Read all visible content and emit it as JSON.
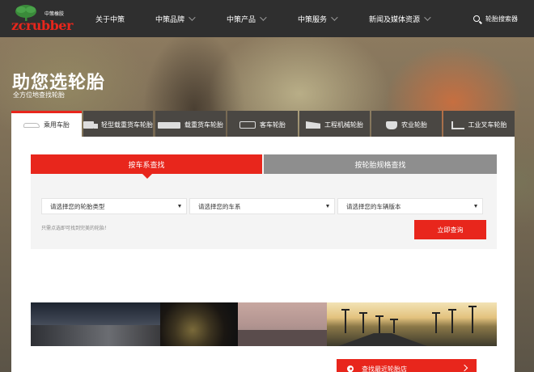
{
  "logo": {
    "brand_cn": "中策橡胶",
    "wordmark_zc": "zc",
    "wordmark_rubber": "rubber",
    "brand_color": "#e8261c"
  },
  "nav": {
    "items": [
      {
        "label": "关于中策",
        "has_dropdown": false
      },
      {
        "label": "中策品牌",
        "has_dropdown": true
      },
      {
        "label": "中策产品",
        "has_dropdown": true
      },
      {
        "label": "中策服务",
        "has_dropdown": true
      },
      {
        "label": "新闻及媒体资源",
        "has_dropdown": true
      }
    ],
    "search_label": "轮胎搜索器"
  },
  "hero": {
    "title": "助您选轮胎",
    "subtitle": "全方位地查找轮胎"
  },
  "tabs": [
    {
      "label": "乘用车胎",
      "icon": "car-icon",
      "active": true
    },
    {
      "label": "轻型载重货车轮胎",
      "icon": "truck-icon",
      "active": false
    },
    {
      "label": "载重货车轮胎",
      "icon": "trailer-truck-icon",
      "active": false
    },
    {
      "label": "客车轮胎",
      "icon": "bus-icon",
      "active": false
    },
    {
      "label": "工程机械轮胎",
      "icon": "dump-truck-icon",
      "active": false
    },
    {
      "label": "农业轮胎",
      "icon": "tractor-icon",
      "active": false
    },
    {
      "label": "工业叉车轮胎",
      "icon": "forklift-icon",
      "active": false
    }
  ],
  "search": {
    "tab_by_vehicle": "按车系查找",
    "tab_by_size": "按轮胎规格查找",
    "select_tire_type": "请选择您的轮胎类型",
    "select_series": "请选择您的车系",
    "select_model": "请选择您的车辆版本",
    "hint": "只需点选即可找到完美的轮胎！",
    "query_button": "立即查询"
  },
  "store_button": "查找最近轮胎店",
  "colors": {
    "accent": "#e8261c",
    "nav_bg": "#2f2f2f",
    "tab_bg": "#4a4743",
    "inactive_search_tab": "#8e8e8e"
  }
}
